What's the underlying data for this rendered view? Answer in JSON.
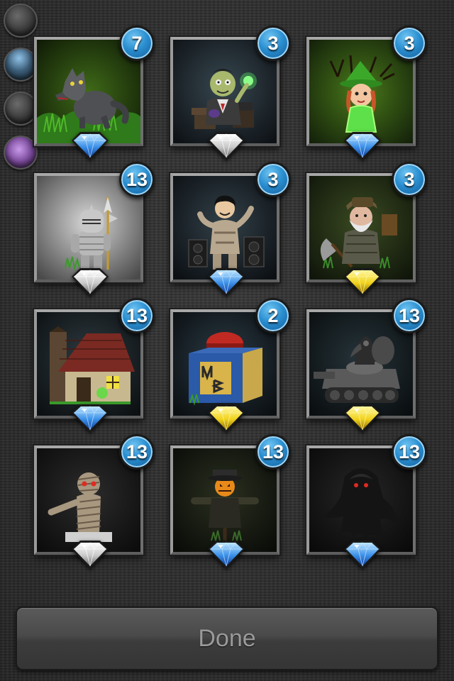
{
  "side_orbs": [
    {
      "name": "orb-1",
      "color": "#3a3a3a"
    },
    {
      "name": "orb-2",
      "color": "#3d5f7a"
    },
    {
      "name": "orb-3",
      "color": "#3a3a3a"
    },
    {
      "name": "orb-4",
      "color": "#7a4a9a"
    }
  ],
  "cards": [
    {
      "name": "werewolf",
      "count": "7",
      "gem": "blue"
    },
    {
      "name": "mad-scientist",
      "count": "3",
      "gem": "silver"
    },
    {
      "name": "forest-witch",
      "count": "3",
      "gem": "blue"
    },
    {
      "name": "knight",
      "count": "13",
      "gem": "silver"
    },
    {
      "name": "rock-singer",
      "count": "3",
      "gem": "blue"
    },
    {
      "name": "lumberjack-dwarf",
      "count": "3",
      "gem": "gold"
    },
    {
      "name": "haunted-house",
      "count": "13",
      "gem": "blue"
    },
    {
      "name": "jack-in-the-box",
      "count": "2",
      "gem": "gold"
    },
    {
      "name": "plague-doctor-tank",
      "count": "13",
      "gem": "gold"
    },
    {
      "name": "mummy",
      "count": "13",
      "gem": "silver"
    },
    {
      "name": "scarecrow",
      "count": "13",
      "gem": "blue"
    },
    {
      "name": "shadow-wraith",
      "count": "13",
      "gem": "blue"
    }
  ],
  "gem_colors": {
    "blue": {
      "light": "#bfe6ff",
      "mid": "#3b8fe8",
      "dark": "#0f3d9a"
    },
    "silver": {
      "light": "#ffffff",
      "mid": "#c9c9c9",
      "dark": "#6b6b6b"
    },
    "gold": {
      "light": "#fff7a0",
      "mid": "#f0d21c",
      "dark": "#8a6a00"
    }
  },
  "done_label": "Done"
}
